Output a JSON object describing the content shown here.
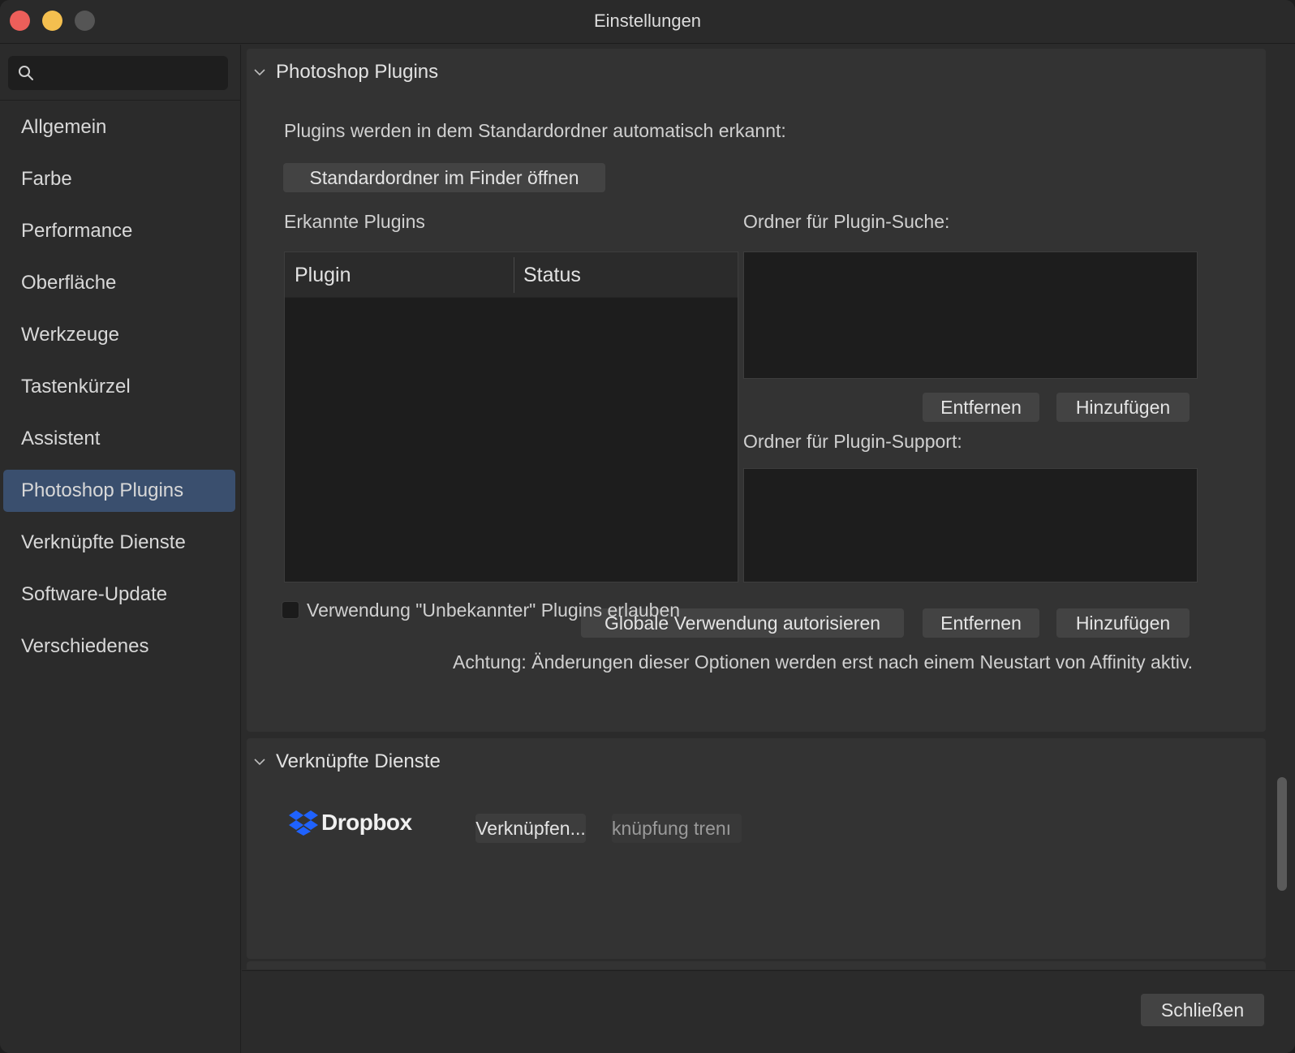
{
  "window": {
    "title": "Einstellungen"
  },
  "sidebar": {
    "search_placeholder": "",
    "items": [
      {
        "label": "Allgemein"
      },
      {
        "label": "Farbe"
      },
      {
        "label": "Performance"
      },
      {
        "label": "Oberfläche"
      },
      {
        "label": "Werkzeuge"
      },
      {
        "label": "Tastenkürzel"
      },
      {
        "label": "Assistent"
      },
      {
        "label": "Photoshop Plugins",
        "selected": true
      },
      {
        "label": "Verknüpfte Dienste"
      },
      {
        "label": "Software-Update"
      },
      {
        "label": "Verschiedenes"
      }
    ]
  },
  "photoshop_plugins": {
    "title": "Photoshop Plugins",
    "intro": "Plugins werden in dem Standardordner automatisch erkannt:",
    "open_folder_button": "Standardordner im Finder öffnen",
    "detected_label": "Erkannte Plugins",
    "table": {
      "col_plugin": "Plugin",
      "col_status": "Status",
      "rows": []
    },
    "search_folders_label": "Ordner für Plugin-Suche:",
    "support_folders_label": "Ordner für Plugin-Support:",
    "remove_button": "Entfernen",
    "add_button": "Hinzufügen",
    "unknown_plugins_checkbox": "Verwendung \"Unbekannter\" Plugins erlauben",
    "unknown_plugins_checked": false,
    "global_authorize_button": "Globale Verwendung autorisieren",
    "warning": "Achtung: Änderungen dieser Optionen werden erst nach einem Neustart von Affinity aktiv."
  },
  "linked_services": {
    "title": "Verknüpfte Dienste",
    "service_name": "Dropbox",
    "link_button": "Verknüpfen...",
    "unlink_button": "knüpfung trenı"
  },
  "footer": {
    "close_button": "Schließen"
  },
  "colors": {
    "accent_selected": "#3a4f6e",
    "dropbox_blue": "#1f62fe",
    "close": "#ec5f5a",
    "minimize": "#f4bf4f"
  }
}
